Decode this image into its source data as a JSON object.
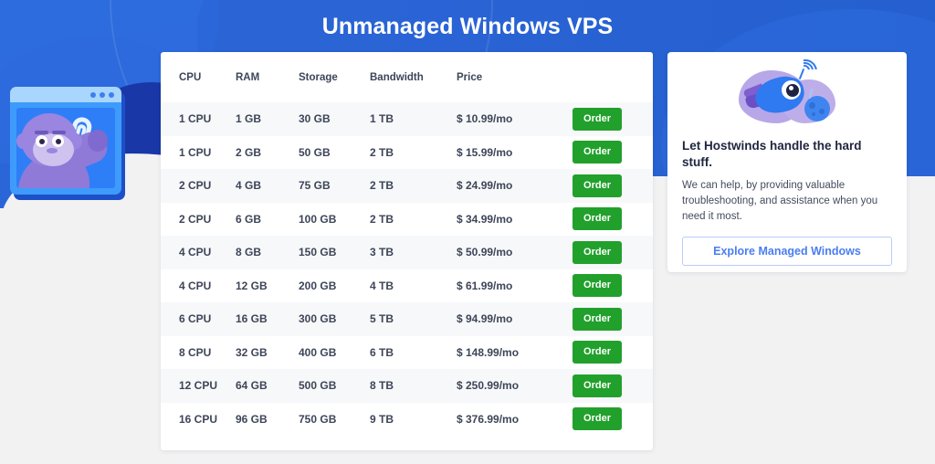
{
  "page": {
    "title": "Unmanaged Windows VPS",
    "accent_blue": "#2a63d4",
    "order_green": "#22a02c",
    "link_blue": "#4a7ef0"
  },
  "mascot": {
    "icon": "gorilla-in-browser-window-illustration"
  },
  "table": {
    "columns": [
      "CPU",
      "RAM",
      "Storage",
      "Bandwidth",
      "Price",
      ""
    ],
    "order_label": "Order",
    "rows": [
      {
        "cpu": "1 CPU",
        "ram": "1 GB",
        "storage": "30 GB",
        "bandwidth": "1 TB",
        "price": "$ 10.99/mo",
        "action": "Order"
      },
      {
        "cpu": "1 CPU",
        "ram": "2 GB",
        "storage": "50 GB",
        "bandwidth": "2 TB",
        "price": "$ 15.99/mo",
        "action": "Order"
      },
      {
        "cpu": "2 CPU",
        "ram": "4 GB",
        "storage": "75 GB",
        "bandwidth": "2 TB",
        "price": "$ 24.99/mo",
        "action": "Order"
      },
      {
        "cpu": "2 CPU",
        "ram": "6 GB",
        "storage": "100 GB",
        "bandwidth": "2 TB",
        "price": "$ 34.99/mo",
        "action": "Order"
      },
      {
        "cpu": "4 CPU",
        "ram": "8 GB",
        "storage": "150 GB",
        "bandwidth": "3 TB",
        "price": "$ 50.99/mo",
        "action": "Order"
      },
      {
        "cpu": "4 CPU",
        "ram": "12 GB",
        "storage": "200 GB",
        "bandwidth": "4 TB",
        "price": "$ 61.99/mo",
        "action": "Order"
      },
      {
        "cpu": "6 CPU",
        "ram": "16 GB",
        "storage": "300 GB",
        "bandwidth": "5 TB",
        "price": "$ 94.99/mo",
        "action": "Order"
      },
      {
        "cpu": "8 CPU",
        "ram": "32 GB",
        "storage": "400 GB",
        "bandwidth": "6 TB",
        "price": "$ 148.99/mo",
        "action": "Order"
      },
      {
        "cpu": "12 CPU",
        "ram": "64 GB",
        "storage": "500 GB",
        "bandwidth": "8 TB",
        "price": "$ 250.99/mo",
        "action": "Order"
      },
      {
        "cpu": "16 CPU",
        "ram": "96 GB",
        "storage": "750 GB",
        "bandwidth": "9 TB",
        "price": "$ 376.99/mo",
        "action": "Order"
      }
    ]
  },
  "promo": {
    "art_icon": "rocket-and-moon-illustration",
    "title": "Let Hostwinds handle the hard stuff.",
    "body": "We can help, by providing valuable troubleshooting, and assistance when you need it most.",
    "button_label": "Explore Managed Windows"
  }
}
